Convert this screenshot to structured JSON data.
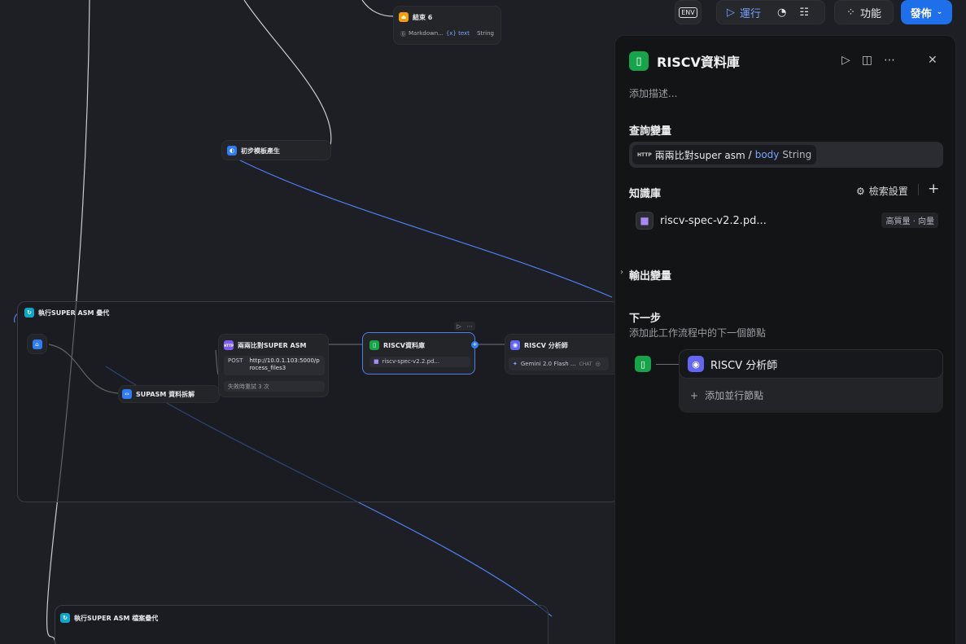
{
  "toolbar": {
    "env_label": "ENV",
    "run_label": "運行",
    "features_label": "功能",
    "publish_label": "發佈"
  },
  "nodes": {
    "end6": {
      "title": "結束 6",
      "field": "Markdown...",
      "var": "{x} text",
      "type": "String"
    },
    "prelim": {
      "title": "初步模板產生"
    },
    "group1": {
      "title": "執行SUPER ASM 疊代"
    },
    "supasm": {
      "title": "SUPASM 資料拆解"
    },
    "http": {
      "title": "兩兩比對SUPER ASM",
      "method": "POST",
      "url": "http://10.0.1.103:5000/process_files3",
      "retry": "失敗時重試 3 次"
    },
    "riscv_kb": {
      "title": "RISCV資料庫",
      "file": "riscv-spec-v2.2.pd..."
    },
    "riscv_an": {
      "title": "RISCV 分析師",
      "model": "Gemini 2.0 Flash ...",
      "mode": "CHAT"
    },
    "group2": {
      "title": "執行SUPER ASM 檔案疊代"
    }
  },
  "panel": {
    "title": "RISCV資料庫",
    "add_desc": "添加描述...",
    "query_label": "查詢變量",
    "query_chip": {
      "tag": "HTTP",
      "node": "兩兩比對super asm",
      "sep": "/",
      "var": "body",
      "type": "String"
    },
    "kb_label": "知識庫",
    "search_settings": "檢索設置",
    "kb_file": "riscv-spec-v2.2.pd...",
    "kb_badge": "高質量 · 向量",
    "output_label": "輸出變量",
    "next_label": "下一步",
    "next_desc": "添加此工作流程中的下一個節點",
    "next_node": "RISCV 分析師",
    "add_parallel": "添加並行節點"
  }
}
